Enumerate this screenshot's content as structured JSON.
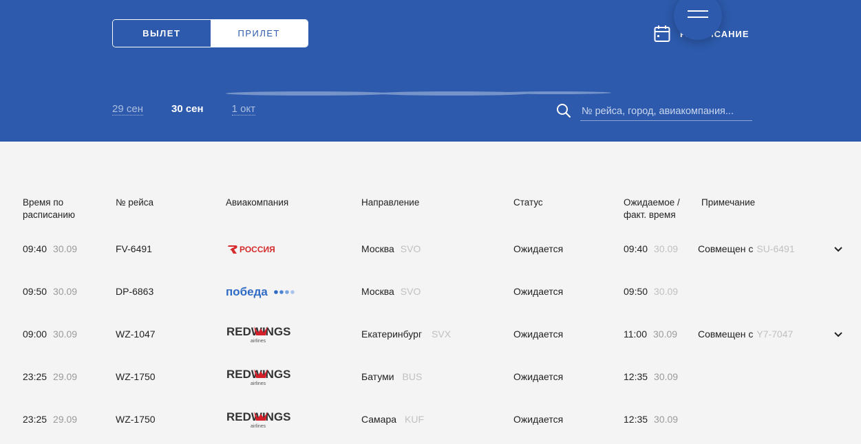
{
  "header": {
    "departure_label": "ВЫЛЕТ",
    "arrival_label": "ПРИЛЕТ",
    "schedule_label": "РАСПИСАНИЕ",
    "dates": [
      "29 сен",
      "30 сен",
      "1 окт"
    ],
    "active_date": "30 сен",
    "search_placeholder": "№ рейса, город, авиакомпания...",
    "icons": [
      "menu-icon",
      "calendar-icon",
      "search-icon"
    ]
  },
  "table": {
    "columns": [
      "Время по расписанию",
      "№ рейса",
      "Авиакомпания",
      "Направление",
      "Статус",
      "Ожидаемое / факт. время",
      "Примечание"
    ],
    "rows": [
      {
        "time": "09:40",
        "date": "30.09",
        "flight": "FV-6491",
        "airline": "РОССИЯ",
        "city": "Москва",
        "code": "SVO",
        "status": "Ожидается",
        "exp_time": "09:40",
        "exp_date": "30.09",
        "note_prefix": "Совмещен с",
        "note_code": "SU-6491",
        "has_expand": true
      },
      {
        "time": "09:50",
        "date": "30.09",
        "flight": "DP-6863",
        "airline": "победа",
        "city": "Москва",
        "code": "SVO",
        "status": "Ожидается",
        "exp_time": "09:50",
        "exp_date": "30.09",
        "note_prefix": "",
        "note_code": "",
        "has_expand": false
      },
      {
        "time": "09:00",
        "date": "30.09",
        "flight": "WZ-1047",
        "airline": "REDWINGS",
        "city": "Екатеринбург",
        "code": "SVX",
        "status": "Ожидается",
        "exp_time": "11:00",
        "exp_date": "30.09",
        "note_prefix": "Совмещен с",
        "note_code": "Y7-7047",
        "has_expand": true
      },
      {
        "time": "23:25",
        "date": "29.09",
        "flight": "WZ-1750",
        "airline": "REDWINGS",
        "city": "Батуми",
        "code": "BUS",
        "status": "Ожидается",
        "exp_time": "12:35",
        "exp_date": "30.09",
        "note_prefix": "",
        "note_code": "",
        "has_expand": false
      },
      {
        "time": "23:25",
        "date": "29.09",
        "flight": "WZ-1750",
        "airline": "REDWINGS",
        "city": "Самара",
        "code": "KUF",
        "status": "Ожидается",
        "exp_time": "12:35",
        "exp_date": "30.09",
        "note_prefix": "",
        "note_code": "",
        "has_expand": false
      }
    ],
    "redwings_sub": "airlines"
  },
  "colors": {
    "header_bg": "#2d5aac",
    "page_bg": "#f4f4f4",
    "aeroflot_red": "#d52b2b",
    "pobeda_blue": "#2e6bc4",
    "redwings_red": "#d4202b"
  }
}
